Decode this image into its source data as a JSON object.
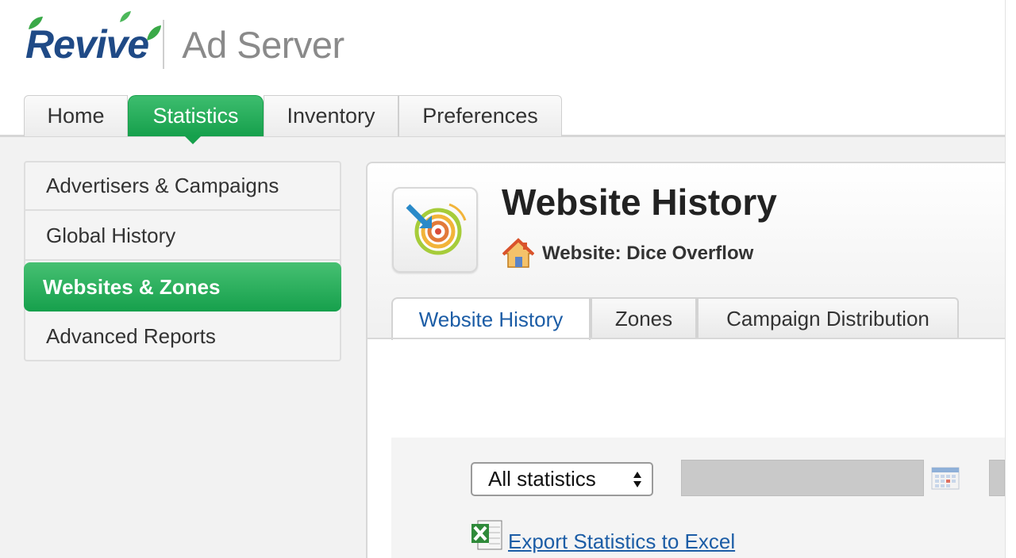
{
  "logo": {
    "brand": "Revive",
    "product": "Ad Server"
  },
  "topnav": {
    "tabs": [
      "Home",
      "Statistics",
      "Inventory",
      "Preferences"
    ],
    "active": "Statistics"
  },
  "sidebar": {
    "items": [
      "Advertisers & Campaigns",
      "Global History",
      "Websites & Zones",
      "Advanced Reports"
    ],
    "active": "Websites & Zones"
  },
  "page": {
    "title": "Website History",
    "breadcrumb": "Website: Dice Overflow"
  },
  "subtabs": {
    "items": [
      "Website History",
      "Zones",
      "Campaign Distribution"
    ],
    "active": "Website History"
  },
  "filter": {
    "period_select": "All statistics",
    "export_link": "Export Statistics to Excel"
  },
  "colors": {
    "accent_green": "#16a04c",
    "link_blue": "#1c5da6",
    "brand_blue": "#1f4a86"
  },
  "icons": [
    "website-stats-icon",
    "house-icon",
    "calendar-icon",
    "excel-icon",
    "leaf-icon"
  ]
}
